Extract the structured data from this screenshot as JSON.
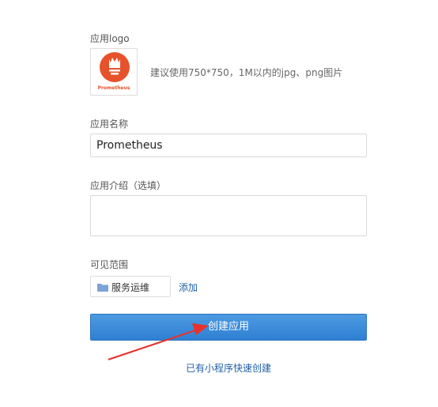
{
  "form": {
    "logo_label": "应用logo",
    "logo_word": "Prometheus",
    "logo_hint": "建议使用750*750，1M以内的jpg、png图片",
    "name_label": "应用名称",
    "name_value": "Prometheus",
    "intro_label": "应用介绍（选填）",
    "intro_value": "",
    "scope_label": "可见范围",
    "scope_chip": "服务运维",
    "add_link": "添加",
    "create_button": "创建应用",
    "mini_program_link": "已有小程序快速创建"
  },
  "colors": {
    "brand_logo": "#e6522c",
    "primary_button": "#3a8bd9",
    "link": "#1f5fa8",
    "annotation_arrow": "#e8322b"
  },
  "icons": [
    "prometheus-logo-icon",
    "folder-icon",
    "annotation-arrow-icon"
  ]
}
